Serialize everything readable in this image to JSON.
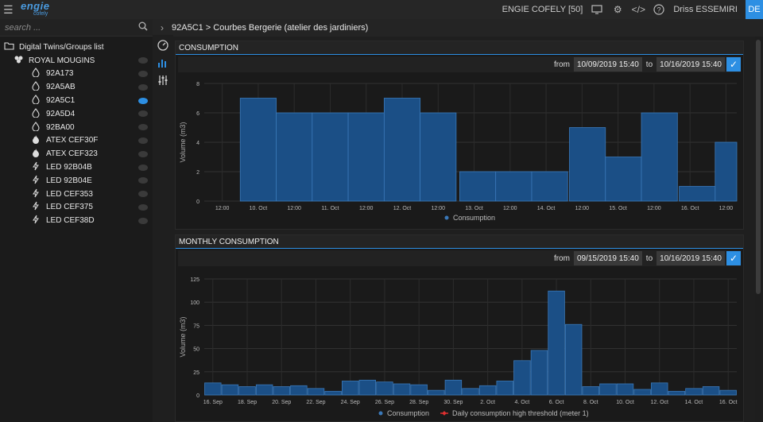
{
  "topbar": {
    "brand": "engie",
    "brand_sub": "cofely",
    "company": "ENGIE COFELY [50]",
    "user": "Driss ESSEMIRI",
    "lang": "DE"
  },
  "search": {
    "placeholder": "search ..."
  },
  "breadcrumb": "92A5C1 > Courbes Bergerie (atelier des jardiniers)",
  "tree": [
    {
      "label": "Digital Twins/Groups list",
      "level": 0,
      "icon": "folder-icon",
      "eye": false
    },
    {
      "label": "ROYAL MOUGINS",
      "level": 1,
      "icon": "group-icon",
      "eye": "off"
    },
    {
      "label": "92A173",
      "level": 2,
      "icon": "drop-icon",
      "eye": "off"
    },
    {
      "label": "92A5AB",
      "level": 2,
      "icon": "drop-icon",
      "eye": "off"
    },
    {
      "label": "92A5C1",
      "level": 2,
      "icon": "drop-icon",
      "eye": "on"
    },
    {
      "label": "92A5D4",
      "level": 2,
      "icon": "drop-icon",
      "eye": "off"
    },
    {
      "label": "92BA00",
      "level": 2,
      "icon": "drop-icon",
      "eye": "off"
    },
    {
      "label": "ATEX CEF30F",
      "level": 2,
      "icon": "flame-icon",
      "eye": "off"
    },
    {
      "label": "ATEX CEF323",
      "level": 2,
      "icon": "flame-icon",
      "eye": "off"
    },
    {
      "label": "LED 92B04B",
      "level": 2,
      "icon": "bolt-icon",
      "eye": "off"
    },
    {
      "label": "LED 92B04E",
      "level": 2,
      "icon": "bolt-icon",
      "eye": "off"
    },
    {
      "label": "LED CEF353",
      "level": 2,
      "icon": "bolt-icon",
      "eye": "off"
    },
    {
      "label": "LED CEF375",
      "level": 2,
      "icon": "bolt-icon",
      "eye": "off"
    },
    {
      "label": "LED CEF38D",
      "level": 2,
      "icon": "bolt-icon",
      "eye": "off"
    }
  ],
  "panel1": {
    "title": "CONSUMPTION",
    "from_label": "from",
    "from": "10/09/2019 15:40",
    "to_label": "to",
    "to": "10/16/2019 15:40"
  },
  "panel2": {
    "title": "MONTHLY CONSUMPTION",
    "from_label": "from",
    "from": "09/15/2019 15:40",
    "to_label": "to",
    "to": "10/16/2019 15:40"
  },
  "colors": {
    "accent": "#2d8fe3",
    "bar": "#1b4f86",
    "bar_stroke": "#3a78b8",
    "threshold": "#e03030"
  },
  "chart_data": [
    {
      "type": "bar",
      "ylabel": "Volume (m3)",
      "ylim": [
        0,
        8
      ],
      "yticks": [
        0,
        2,
        4,
        6,
        8
      ],
      "xlim": [
        0,
        14
      ],
      "xticks": [
        {
          "at": 0.5,
          "label": "12:00"
        },
        {
          "at": 1.5,
          "label": "10. Oct"
        },
        {
          "at": 2.5,
          "label": "12:00"
        },
        {
          "at": 3.5,
          "label": "11. Oct"
        },
        {
          "at": 4.5,
          "label": "12:00"
        },
        {
          "at": 5.5,
          "label": "12. Oct"
        },
        {
          "at": 6.5,
          "label": "12:00"
        },
        {
          "at": 7.5,
          "label": "13. Oct"
        },
        {
          "at": 8.5,
          "label": "12:00"
        },
        {
          "at": 9.5,
          "label": "14. Oct"
        },
        {
          "at": 10.5,
          "label": "12:00"
        },
        {
          "at": 11.5,
          "label": "15. Oct"
        },
        {
          "at": 12.5,
          "label": "12:00"
        },
        {
          "at": 13.5,
          "label": "16. Oct"
        },
        {
          "at": 14.5,
          "label": "12:00"
        }
      ],
      "series": [
        {
          "name": "Consumption",
          "bars": [
            {
              "x0": 1.0,
              "x1": 2.0,
              "v": 7
            },
            {
              "x0": 2.0,
              "x1": 3.0,
              "v": 6
            },
            {
              "x0": 3.0,
              "x1": 4.0,
              "v": 6
            },
            {
              "x0": 4.0,
              "x1": 5.0,
              "v": 6
            },
            {
              "x0": 5.0,
              "x1": 6.0,
              "v": 7
            },
            {
              "x0": 6.0,
              "x1": 7.0,
              "v": 6
            },
            {
              "x0": 7.1,
              "x1": 8.1,
              "v": 2
            },
            {
              "x0": 8.1,
              "x1": 9.1,
              "v": 2
            },
            {
              "x0": 9.1,
              "x1": 10.1,
              "v": 2
            },
            {
              "x0": 10.15,
              "x1": 11.15,
              "v": 5
            },
            {
              "x0": 11.15,
              "x1": 12.15,
              "v": 3
            },
            {
              "x0": 12.15,
              "x1": 13.15,
              "v": 6
            },
            {
              "x0": 13.2,
              "x1": 14.2,
              "v": 1
            },
            {
              "x0": 14.2,
              "x1": 14.8,
              "v": 4
            }
          ]
        }
      ],
      "legend": [
        "Consumption"
      ],
      "legend_position": "bottom"
    },
    {
      "type": "bar",
      "ylabel": "Volume (m3)",
      "ylim": [
        0,
        125
      ],
      "yticks": [
        0,
        25,
        50,
        75,
        100,
        125
      ],
      "categories": [
        "16. Sep",
        "17. Sep",
        "18. Sep",
        "19. Sep",
        "20. Sep",
        "21. Sep",
        "22. Sep",
        "23. Sep",
        "24. Sep",
        "25. Sep",
        "26. Sep",
        "27. Sep",
        "28. Sep",
        "29. Sep",
        "30. Sep",
        "1. Oct",
        "2. Oct",
        "3. Oct",
        "4. Oct",
        "5. Oct",
        "6. Oct",
        "7. Oct",
        "8. Oct",
        "9. Oct",
        "10. Oct",
        "11. Oct",
        "12. Oct",
        "13. Oct",
        "14. Oct",
        "15. Oct",
        "16. Oct"
      ],
      "xtick_labels": [
        "16. Sep",
        "18. Sep",
        "20. Sep",
        "22. Sep",
        "24. Sep",
        "26. Sep",
        "28. Sep",
        "30. Sep",
        "2. Oct",
        "4. Oct",
        "6. Oct",
        "8. Oct",
        "10. Oct",
        "12. Oct",
        "14. Oct",
        "16. Oct"
      ],
      "series": [
        {
          "name": "Consumption",
          "values": [
            13,
            11,
            9,
            11,
            9,
            10,
            7,
            4,
            15,
            16,
            14,
            12,
            11,
            5,
            16,
            7,
            10,
            15,
            37,
            48,
            112,
            76,
            9,
            12,
            12,
            6,
            13,
            4,
            7,
            9,
            5
          ]
        },
        {
          "name": "Daily consumption high threshold (meter 1)",
          "values": []
        }
      ],
      "legend": [
        "Consumption",
        "Daily consumption high threshold (meter 1)"
      ],
      "legend_position": "bottom"
    }
  ]
}
